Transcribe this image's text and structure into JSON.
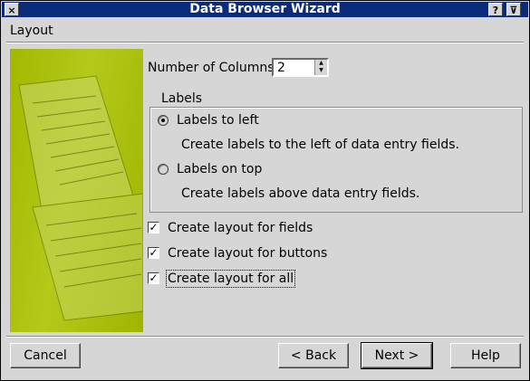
{
  "window": {
    "title": "Data Browser Wizard",
    "close_glyph": "×",
    "help_glyph": "?",
    "menu_glyph": "⊽"
  },
  "page": {
    "section": "Layout"
  },
  "columns": {
    "label": "Number of Columns:",
    "value": "2"
  },
  "labels_group": {
    "title": "Labels",
    "options": [
      {
        "label": "Labels to left",
        "description": "Create labels to the left of data entry fields.",
        "selected": true
      },
      {
        "label": "Labels on top",
        "description": "Create labels above data entry fields.",
        "selected": false
      }
    ]
  },
  "checkboxes": [
    {
      "label": "Create layout for fields",
      "checked": true
    },
    {
      "label": "Create layout for buttons",
      "checked": true
    },
    {
      "label": "Create layout for all",
      "checked": true
    }
  ],
  "buttons": {
    "cancel": "Cancel",
    "back": "< Back",
    "next": "Next >",
    "help": "Help"
  },
  "colors": {
    "titlebar": "#0a2a7a",
    "banner": "#b4c91a"
  },
  "icons": [
    "close-icon",
    "help-icon",
    "menu-icon",
    "spin-up-icon",
    "spin-down-icon"
  ]
}
